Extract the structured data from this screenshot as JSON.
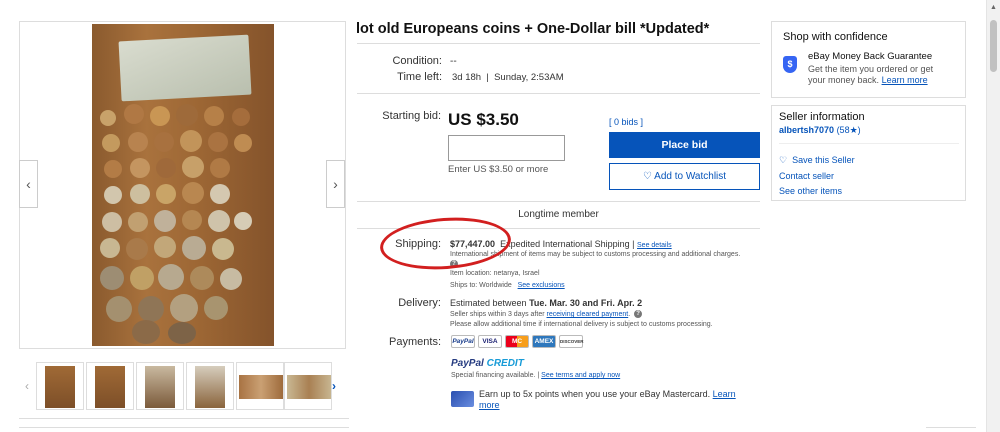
{
  "item": {
    "title": "lot old Europeans coins + One-Dollar bill *Updated*",
    "condition_label": "Condition:",
    "condition_value": "--",
    "time_left_label": "Time left:",
    "time_left_value": "3d 18h",
    "time_left_end": "Sunday, 2:53AM"
  },
  "bid": {
    "starting_bid_label": "Starting bid:",
    "price": "US $3.50",
    "bids_count": "[ 0 bids ]",
    "input_hint": "Enter US $3.50 or more",
    "place_bid": "Place bid",
    "watchlist": "Add to Watchlist",
    "seller_badge": "Longtime member"
  },
  "shipping": {
    "label": "Shipping:",
    "cost": "$77,447.00",
    "method": "Expedited International Shipping",
    "see_details": "See details",
    "customs_note": "International shipment of items may be subject to customs processing and additional charges.",
    "item_location": "Item location:  netanya, Israel",
    "ships_to": "Ships to:  Worldwide",
    "see_exclusions": "See exclusions"
  },
  "delivery": {
    "label": "Delivery:",
    "estimate_prefix": "Estimated between",
    "estimate_range": "Tue. Mar. 30 and Fri. Apr. 2",
    "handling": "Seller ships within 3 days after",
    "handling_link": "receiving cleared payment",
    "note": "Please allow additional time if international delivery is subject to customs processing."
  },
  "payments": {
    "label": "Payments:",
    "cards": [
      "PayPal",
      "VISA",
      "MC",
      "AMEX",
      "DISCOVER"
    ],
    "paypal_credit_1": "PayPal",
    "paypal_credit_2": "CREDIT",
    "financing": "Special financing available.",
    "financing_link": "See terms and apply now",
    "mastercard_promo": "Earn up to 5x points when you use your eBay Mastercard.",
    "mastercard_link_1": "Learn",
    "mastercard_link_2": "more"
  },
  "confidence": {
    "title": "Shop with confidence",
    "guarantee_title": "eBay Money Back Guarantee",
    "guarantee_text_1": "Get the item you ordered or get",
    "guarantee_text_2": "your money back.",
    "learn_more": "Learn more"
  },
  "seller": {
    "title": "Seller information",
    "name": "albertsh7070",
    "score": "(58",
    "score_end": ")",
    "save": "Save this Seller",
    "contact": "Contact seller",
    "other_items": "See other items"
  },
  "colors": {
    "accent_blue": "#0654ba",
    "annotation_red": "#d21f1f"
  },
  "icons": [
    "chevron-left-icon",
    "chevron-right-icon",
    "heart-icon",
    "info-icon",
    "shield-icon",
    "star-icon"
  ]
}
